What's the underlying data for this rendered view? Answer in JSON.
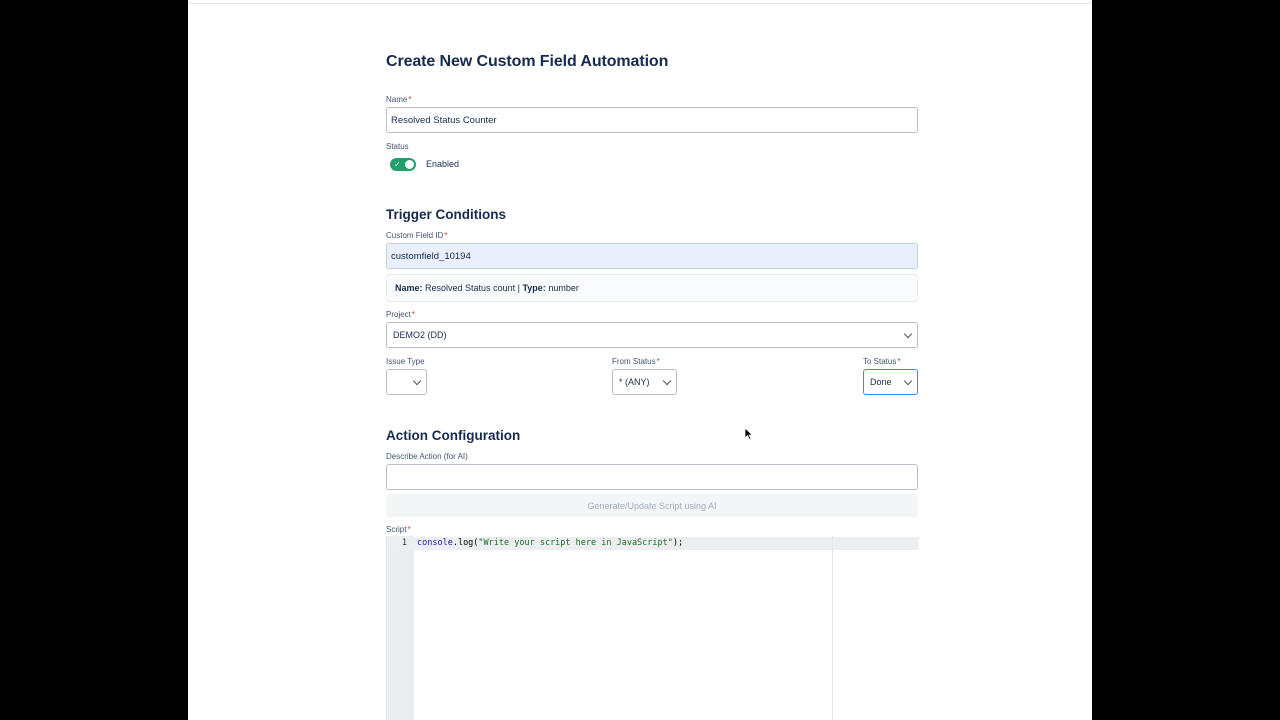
{
  "form": {
    "title": "Create New Custom Field Automation",
    "name_label": "Name",
    "name_value": "Resolved Status Counter",
    "status_label": "Status",
    "status_toggle": "Enabled",
    "required_mark": "*"
  },
  "trigger": {
    "heading": "Trigger Conditions",
    "custom_field_label": "Custom Field ID",
    "custom_field_value": "customfield_10194",
    "hint_name_key": "Name:",
    "hint_name_value": "Resolved Status count |",
    "hint_type_key": "Type:",
    "hint_type_value": "number",
    "project_label": "Project",
    "project_value": "DEMO2 (DD)",
    "issue_type_label": "Issue Type",
    "issue_type_value": "",
    "from_status_label": "From Status",
    "from_status_value": "* (ANY)",
    "to_status_label": "To Status",
    "to_status_value": "Done"
  },
  "action": {
    "heading": "Action Configuration",
    "describe_label": "Describe Action (for AI)",
    "describe_value": "",
    "generate_button": "Generate/Update Script using AI",
    "script_label": "Script",
    "line_number": "1",
    "code_obj": "console",
    "code_fn": ".log(",
    "code_str": "\"Write your script here in JavaScript\"",
    "code_end": ");"
  },
  "colors": {
    "toggle_on": "#22a06b",
    "focus_border": "#388bff",
    "required": "#c9372c"
  }
}
